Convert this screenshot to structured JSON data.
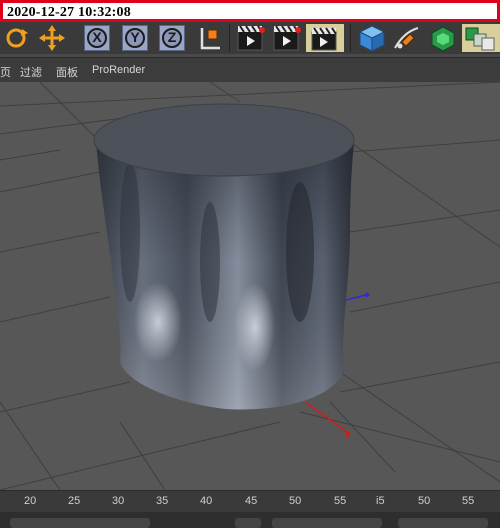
{
  "timestamp": "2020-12-27  10:32:08",
  "toolbar": {
    "axis_labels": [
      "X",
      "Y",
      "Z"
    ],
    "icons": [
      "rotate-icon",
      "move-icon",
      "coordinate-system-icon",
      "render-view-icon",
      "render-picture-viewer-icon",
      "render-settings-icon",
      "cube-icon",
      "pen-icon",
      "subdivide-icon",
      "array-icon"
    ]
  },
  "menubar": {
    "items": [
      "页",
      "过滤",
      "面板",
      "ProRender"
    ]
  },
  "ruler": {
    "labels": [
      "20",
      "25",
      "30",
      "35",
      "40",
      "45",
      "50",
      "55",
      "i5",
      "50",
      "55"
    ]
  },
  "colors": {
    "viewport_bg": "#575757",
    "grid_line": "#3e3e3e",
    "x_axis": "#d11c1c",
    "z_axis": "#2b2bd8",
    "object_dark": "#2b3038",
    "object_light": "#9aa3b2"
  }
}
